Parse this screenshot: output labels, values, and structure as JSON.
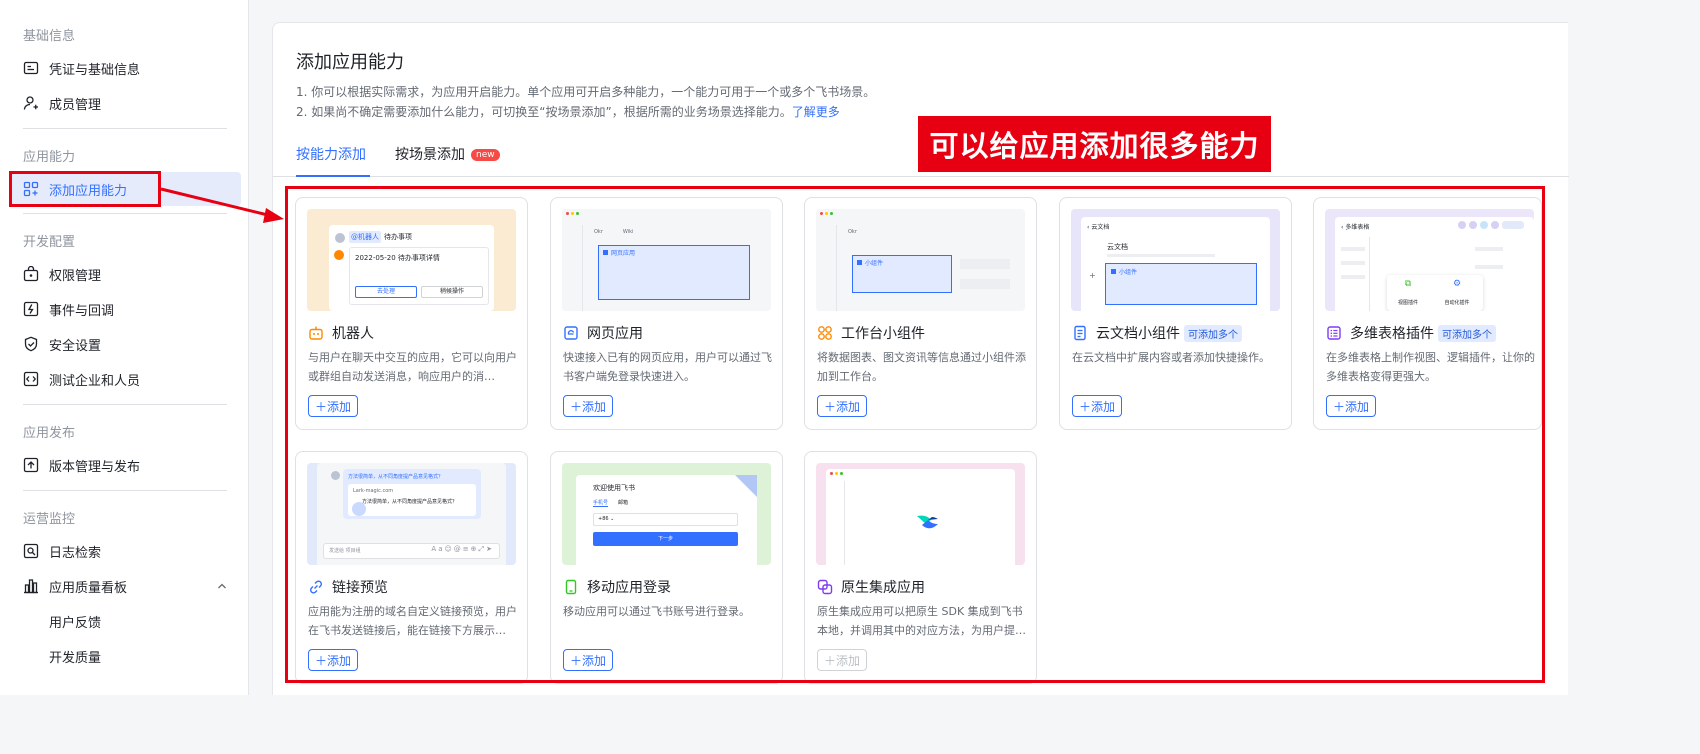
{
  "sidebar": {
    "sections": [
      {
        "title": "基础信息",
        "items": [
          {
            "label": "凭证与基础信息",
            "icon": "credential-icon"
          },
          {
            "label": "成员管理",
            "icon": "member-icon"
          }
        ]
      },
      {
        "title": "应用能力",
        "items": [
          {
            "label": "添加应用能力",
            "icon": "add-capability-icon",
            "active": true
          }
        ]
      },
      {
        "title": "开发配置",
        "items": [
          {
            "label": "权限管理",
            "icon": "permission-icon"
          },
          {
            "label": "事件与回调",
            "icon": "event-icon"
          },
          {
            "label": "安全设置",
            "icon": "shield-icon"
          },
          {
            "label": "测试企业和人员",
            "icon": "test-icon"
          }
        ]
      },
      {
        "title": "应用发布",
        "items": [
          {
            "label": "版本管理与发布",
            "icon": "upload-icon"
          }
        ]
      },
      {
        "title": "运营监控",
        "items": [
          {
            "label": "日志检索",
            "icon": "log-search-icon"
          },
          {
            "label": "应用质量看板",
            "icon": "chart-bar-icon",
            "expanded": true
          },
          {
            "label": "用户反馈",
            "sub": true
          },
          {
            "label": "开发质量",
            "sub": true
          }
        ]
      }
    ]
  },
  "main": {
    "title": "添加应用能力",
    "desc1": "1. 你可以根据实际需求，为应用开启能力。单个应用可开启多种能力，一个能力可用于一个或多个飞书场景。",
    "desc2": "2. 如果尚不确定需要添加什么能力，可切换至“按场景添加”，根据所需的业务场景选择能力。",
    "learn_more": "了解更多",
    "tabs": [
      {
        "label": "按能力添加",
        "active": true
      },
      {
        "label": "按场景添加",
        "badge": "new"
      }
    ],
    "callout": "可以给应用添加很多能力",
    "add_label": "添加",
    "cards": [
      {
        "title": "机器人",
        "icon": "robot-icon",
        "desc": "与用户在聊天中交互的应用，它可以向用户或群组自动发送消息，响应用户的消…",
        "thumb": {
          "chip": "@机器人",
          "chip_text": "待办事项",
          "line": "2022-05-20 待办事项详情",
          "btn1": "去处理",
          "btn2": "稍候操作"
        }
      },
      {
        "title": "网页应用",
        "icon": "web-app-icon",
        "desc": "快速接入已有的网页应用，用户可以通过飞书客户端免登录快速进入。",
        "thumb": {
          "tab1": "Okr",
          "tab2": "Wiki",
          "box": "网页应用"
        }
      },
      {
        "title": "工作台小组件",
        "icon": "widget-icon",
        "desc": "将数据图表、图文资讯等信息通过小组件添加到工作台。",
        "thumb": {
          "tab1": "Okr",
          "box": "小组件"
        }
      },
      {
        "title": "云文档小组件",
        "icon": "doc-widget-icon",
        "tag": "可添加多个",
        "desc": "在云文档中扩展内容或者添加快捷操作。",
        "thumb": {
          "back": "云文档",
          "heading": "云文档",
          "box": "小组件"
        }
      },
      {
        "title": "多维表格插件",
        "icon": "bitable-icon",
        "tag": "可添加多个",
        "desc": "在多维表格上制作视图、逻辑插件，让你的多维表格变得更强大。",
        "thumb": {
          "back": "多维表格",
          "p1": "视图插件",
          "p2": "自动化插件"
        }
      },
      {
        "title": "链接预览",
        "icon": "link-icon",
        "desc": "应用能为注册的域名自定义链接预览，用户在飞书发送链接后，能在链接下方展示…",
        "thumb": {
          "msg": "方法很简单，从不同角度提产品意见格式？",
          "url": "Lark-magic.com",
          "body": "方法很简单，从不同角度提产品意见格式？",
          "placeholder": "发送给 项目组"
        }
      },
      {
        "title": "移动应用登录",
        "icon": "mobile-icon",
        "desc": "移动应用可以通过飞书账号进行登录。",
        "thumb": {
          "welcome": "欢迎使用飞书",
          "t1": "手机号",
          "t2": "邮箱",
          "code": "+86",
          "btn": "下一步"
        }
      },
      {
        "title": "原生集成应用",
        "icon": "native-icon",
        "desc": "原生集成应用可以把原生 SDK 集成到飞书本地，并调用其中的对应方法，为用户提…",
        "disabled": true,
        "thumb": {}
      }
    ]
  },
  "colors": {
    "accent": "#3370ff",
    "annotation_red": "#e60012",
    "active_bg": "#e6ebfb"
  }
}
